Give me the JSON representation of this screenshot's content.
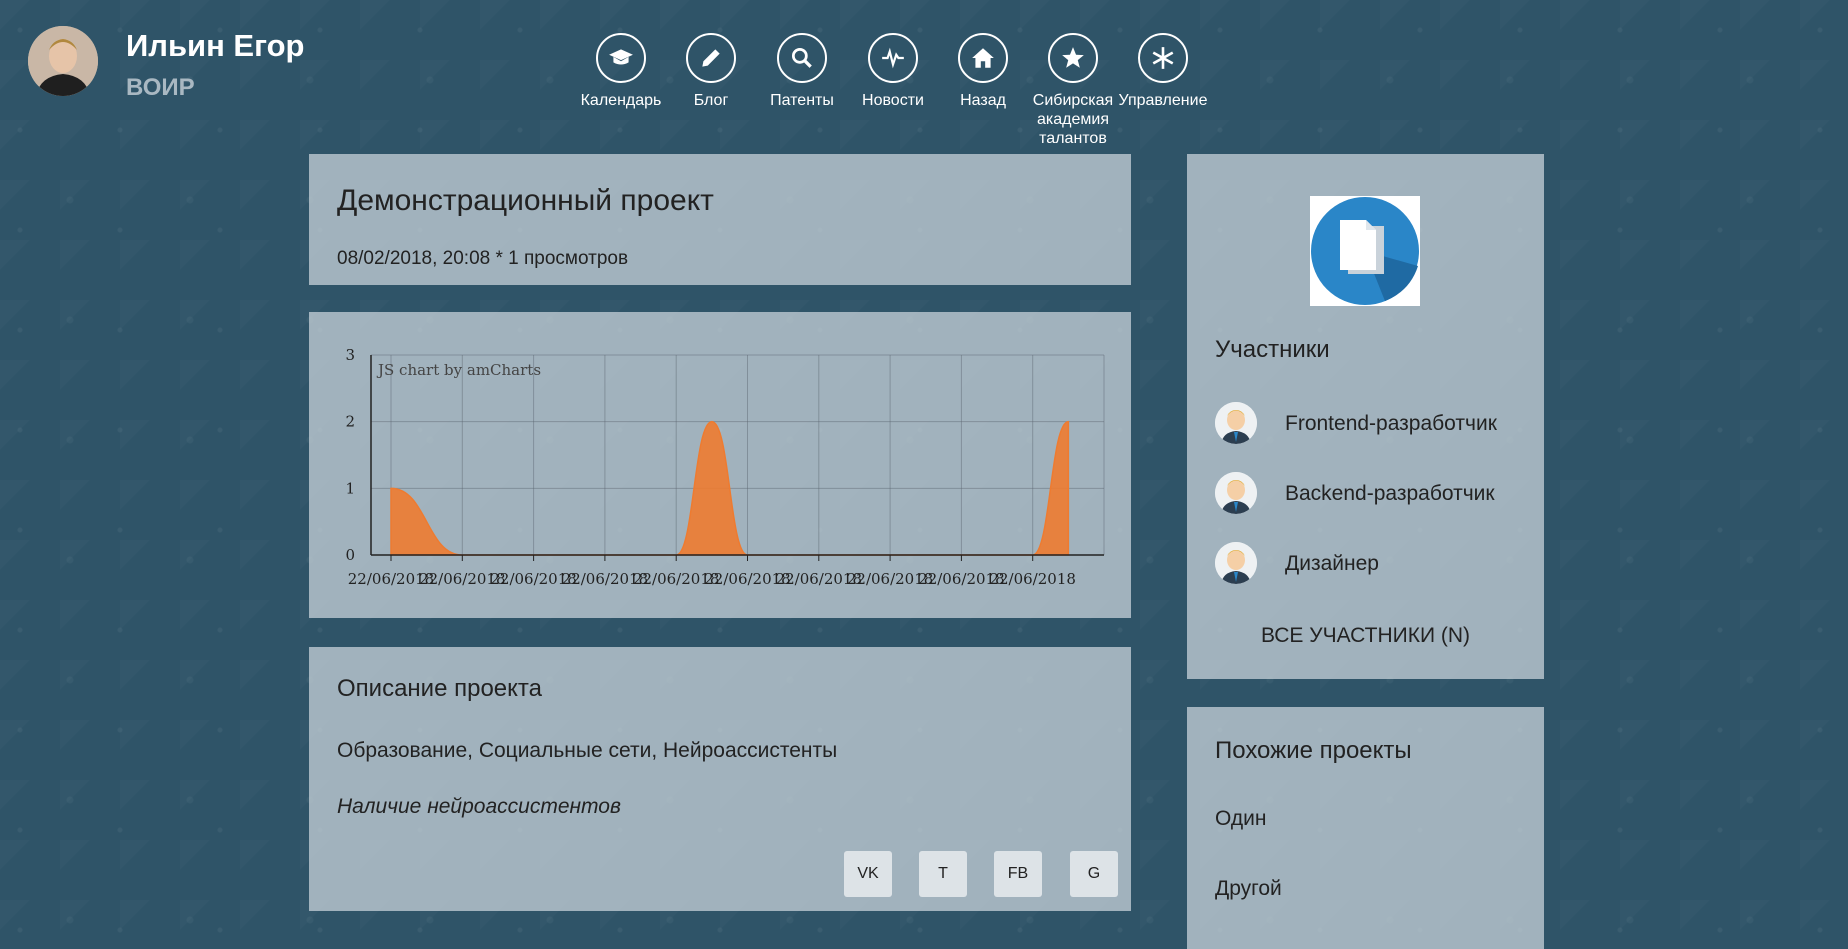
{
  "user": {
    "name": "Ильин Егор",
    "org": "ВОИР"
  },
  "nav": [
    {
      "label": "Календарь",
      "icon": "graduation-cap-icon"
    },
    {
      "label": "Блог",
      "icon": "pencil-icon"
    },
    {
      "label": "Патенты",
      "icon": "search-icon"
    },
    {
      "label": "Новости",
      "icon": "pulse-icon"
    },
    {
      "label": "Назад",
      "icon": "home-icon"
    },
    {
      "label": "Сибирская академия талантов",
      "icon": "star-icon"
    },
    {
      "label": "Управление",
      "icon": "asterisk-icon"
    }
  ],
  "project": {
    "title": "Демонстрационный проект",
    "meta": "08/02/2018, 20:08 * 1 просмотров"
  },
  "chart_data": {
    "type": "area",
    "watermark": "JS chart by amCharts",
    "categories": [
      "22/06/2018",
      "22/06/2018",
      "22/06/2018",
      "22/06/2018",
      "22/06/2018",
      "22/06/2018",
      "22/06/2018",
      "22/06/2018",
      "22/06/2018",
      "22/06/2018"
    ],
    "x": [
      0,
      1,
      2,
      3,
      4,
      4.5,
      5,
      6,
      7,
      8,
      9,
      9.5
    ],
    "values": [
      1,
      0,
      0,
      0,
      0,
      2,
      0,
      0,
      0,
      0,
      0,
      2
    ],
    "ylim": [
      0,
      3
    ],
    "yticks": [
      "0",
      "1",
      "2",
      "3"
    ],
    "grid": true,
    "color": "#ee7b30"
  },
  "description": {
    "title": "Описание проекта",
    "tags": "Образование, Социальные сети, Нейроассистенты",
    "note": "Наличие нейроассистентов"
  },
  "share": [
    "VK",
    "T",
    "FB",
    "G"
  ],
  "members": {
    "title": "Участники",
    "list": [
      {
        "name": "Frontend-разработчик"
      },
      {
        "name": "Backend-разработчик"
      },
      {
        "name": "Дизайнер"
      }
    ],
    "all_label": "ВСЕ УЧАСТНИКИ (N)"
  },
  "similar": {
    "title": "Похожие проекты",
    "items": [
      "Один",
      "Другой"
    ]
  },
  "colors": {
    "background": "#2f5468",
    "panel": "rgba(205,215,222,0.72)",
    "accent": "#ee7b30",
    "icon_blue": "#2a86c8"
  }
}
